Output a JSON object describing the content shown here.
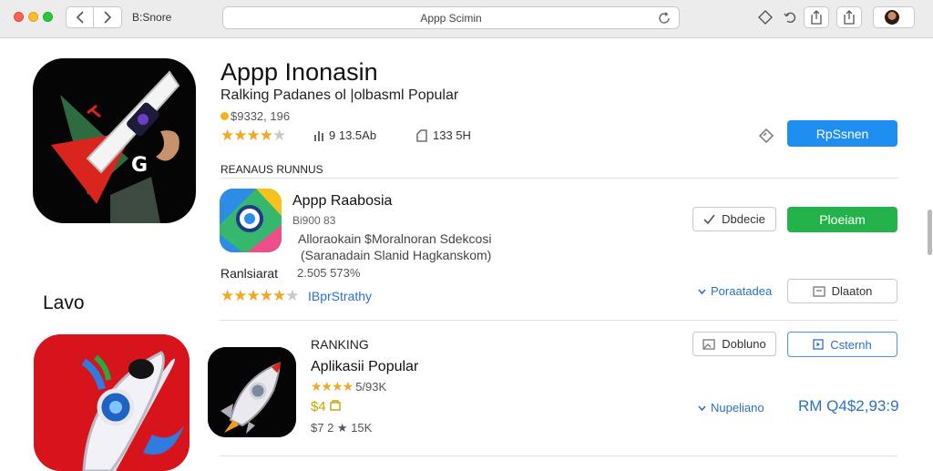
{
  "browser": {
    "breadcrumb": "B:Snore",
    "url": "Appp Scimin"
  },
  "hero": {
    "title": "Appp Inonasin",
    "subtitle": "Ralking Padanes ol |olbasml Popular",
    "price": "$9332, 196",
    "rating_stars": 4,
    "stat_downloads": "9 13.5Ab",
    "stat_size": "133 5H",
    "action_label": "RpSsnen"
  },
  "section": {
    "label": "REANAUS RUNNUS"
  },
  "app1": {
    "name": "Appp Raabosia",
    "price": "Bi900 83",
    "desc_line1": "Alloraokain $Moralnoran Sdekcosi",
    "desc_line2": "(Saranadain Slanid Hagkanskom)",
    "rank_label": "Ranlsiarat",
    "rank_value": "2.505 573%",
    "rating_stars": 5,
    "link_text": "IBprStrathy",
    "secondary_button": "Dbdecie",
    "primary_button": "Ploeiam",
    "chevron_link": "Poraatadea",
    "outline_button": "Dlaaton"
  },
  "lower_label": "Lavo",
  "app2": {
    "ranking_label": "RANKING",
    "name": "Aplikasii Popular",
    "rating_stars": 4,
    "rating_text": "5/93K",
    "price": "$4",
    "count": "$7 2 ★ 15K",
    "secondary_button": "Dobluno",
    "primary_button": "Csternh",
    "chevron_link": "Nupeliano",
    "total": "RM Q4$2,93:9"
  },
  "colors": {
    "accent_blue": "#1f8ef1",
    "accent_green": "#24b24a",
    "star": "#f5a623",
    "link": "#2a72c8"
  }
}
